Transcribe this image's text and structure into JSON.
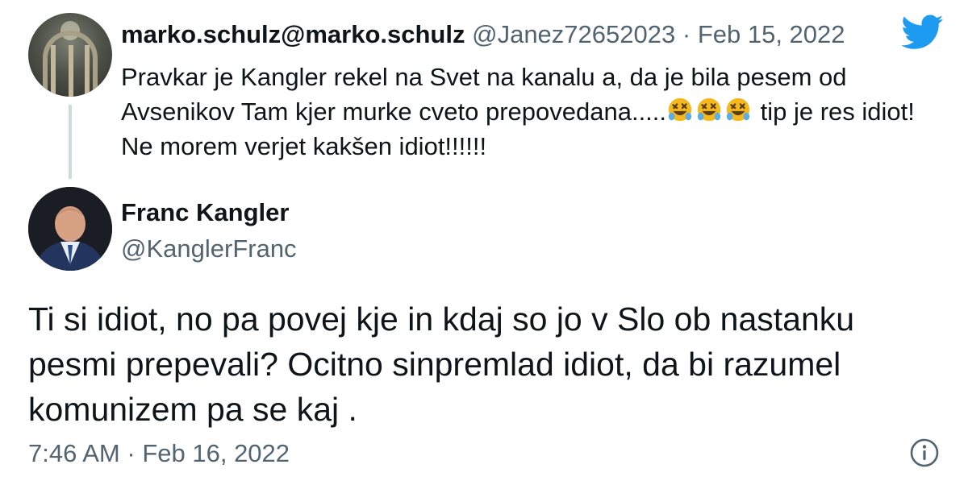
{
  "parent_tweet": {
    "display_name": "marko.schulz@marko.schulz",
    "handle": "@Janez72652023",
    "separator": "·",
    "date": "Feb 15, 2022",
    "text_before_emoji": "Pravkar je Kangler rekel na Svet na kanalu a, da je bila pesem od Avsenikov Tam kjer murke cveto prepovedana.....",
    "emoji_icons": [
      "rolling-on-floor-laughing-icon",
      "rolling-on-floor-laughing-icon",
      "rolling-on-floor-laughing-icon"
    ],
    "text_after_emoji": " tip je res idiot! Ne morem verjet kakšen idiot!!!!!!"
  },
  "reply_tweet": {
    "display_name": "Franc Kangler",
    "handle": "@KanglerFranc",
    "text": "Ti si idiot, no pa povej kje in kdaj so jo v Slo ob nastanku pesmi prepevali? Ocitno sinpremlad idiot, da bi razumel komunizem pa se kaj .",
    "time": "7:46 AM",
    "separator": "·",
    "date": "Feb 16, 2022"
  },
  "icons": {
    "brand": "twitter-bird-icon",
    "info": "info-icon"
  },
  "colors": {
    "brand_blue": "#1d9bf0",
    "text_primary": "#0f1419",
    "text_secondary": "#536471",
    "thread_line": "#cfd9de",
    "emoji_yellow": "#f5b91e"
  }
}
